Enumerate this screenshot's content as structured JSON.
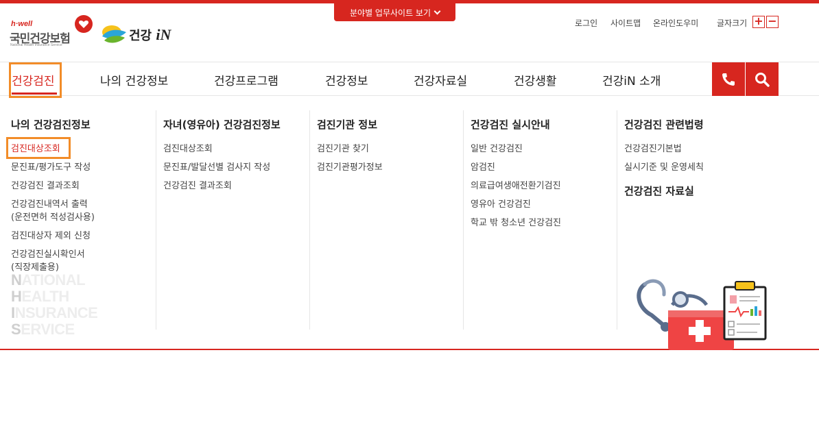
{
  "header": {
    "nhis_logo": {
      "top": "h·well",
      "name": "국민건강보험",
      "sub": "National Health Insurance Service"
    },
    "health_in_logo": {
      "text": "건강",
      "in": "iN"
    },
    "field_button": "분야별 업무사이트 보기",
    "util_links": [
      "로그인",
      "사이트맵",
      "온라인도우미"
    ],
    "font_size_label": "글자크기",
    "font_plus": "+",
    "font_minus": "−"
  },
  "nav": {
    "items": [
      "건강검진",
      "나의 건강정보",
      "건강프로그램",
      "건강정보",
      "건강자료실",
      "건강생활",
      "건강iN 소개"
    ],
    "active_index": 0
  },
  "mega_menu": {
    "columns": [
      {
        "title": "나의 건강검진정보",
        "items": [
          "검진대상조회",
          "문진표/평가도구 작성",
          "건강검진 결과조회",
          "건강검진내역서 출력\n(운전면허 적성검사용)",
          "검진대상자 제외 신청",
          "건강검진실시확인서\n(직장제출용)"
        ]
      },
      {
        "title": "자녀(영유아) 건강검진정보",
        "items": [
          "검진대상조회",
          "문진표/발달선별 검사지 작성",
          "건강검진 결과조회"
        ]
      },
      {
        "title": "검진기관 정보",
        "items": [
          "검진기관 찾기",
          "검진기관평가정보"
        ]
      },
      {
        "title": "건강검진 실시안내",
        "items": [
          "일반 건강검진",
          "암검진",
          "의료급여생애전환기검진",
          "영유아 건강검진",
          "학교 밖 청소년 건강검진"
        ]
      },
      {
        "title": "건강검진 관련법령",
        "items": [
          "건강검진기본법",
          "실시기준 및 운영세칙"
        ],
        "title2": "건강검진 자료실"
      }
    ],
    "watermark": [
      "NATIONAL",
      "HEALTH",
      "INSURANCE",
      "SERVICE"
    ]
  },
  "colors": {
    "brand": "#d7261f",
    "highlight": "#f28c28"
  }
}
